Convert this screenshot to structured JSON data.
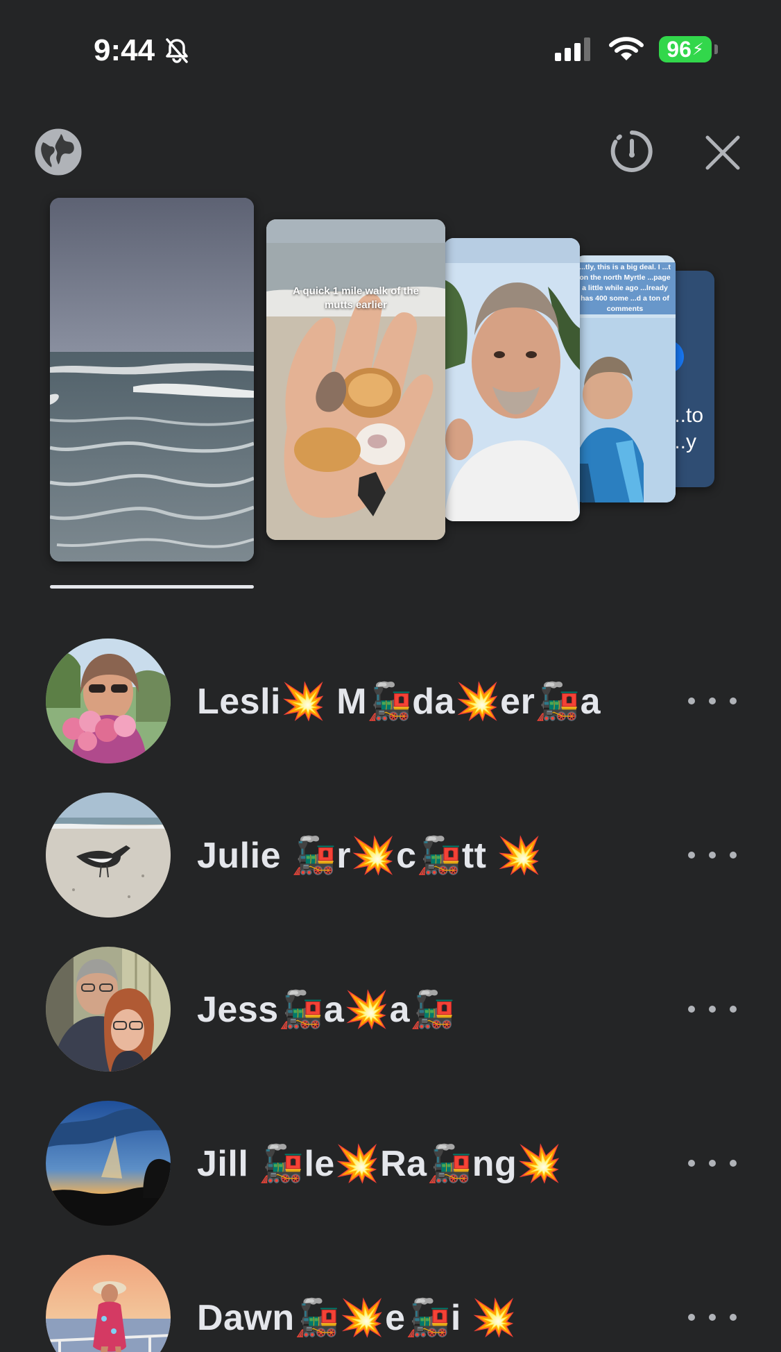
{
  "status_bar": {
    "time": "9:44",
    "battery": "96"
  },
  "top_bar": {
    "privacy_icon": "globe-icon",
    "archive_icon": "story-timer-icon",
    "close_icon": "close-icon"
  },
  "stories": [
    {
      "caption": ""
    },
    {
      "caption": "A quick 1 mile walk of the mutts earlier"
    },
    {
      "caption": ""
    },
    {
      "caption": "...tly, this is a big deal. I ...t on the north Myrtle ...page a little while ago ...lready has 400 some ...d a ton of comments"
    },
    {
      "caption": "...to ...y"
    }
  ],
  "viewers": [
    {
      "name": "Lesli💥 M🚂da💥er🚂a",
      "more_icon": "more-horizontal-icon"
    },
    {
      "name": "Julie 🚂r💥c🚂tt 💥",
      "more_icon": "more-horizontal-icon"
    },
    {
      "name": "Jess🚂a💥a🚂",
      "more_icon": "more-horizontal-icon"
    },
    {
      "name": "Jill 🚂le💥Ra🚂ng💥",
      "more_icon": "more-horizontal-icon"
    },
    {
      "name": "Dawn🚂💥e🚂i 💥",
      "more_icon": "more-horizontal-icon"
    }
  ],
  "colors": {
    "background": "#242526",
    "text": "#e4e6eb",
    "battery": "#32d74b"
  }
}
